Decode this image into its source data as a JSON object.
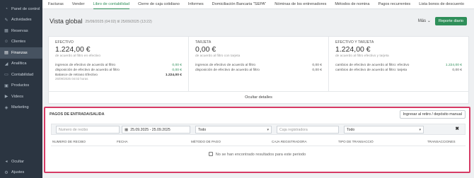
{
  "sidebar": {
    "items": [
      {
        "icon": "dashboard-icon",
        "glyph": "◔",
        "label": "Panel de control"
      },
      {
        "icon": "activities-icon",
        "glyph": "✎",
        "label": "Actividades"
      },
      {
        "icon": "calendar-icon",
        "glyph": "▦",
        "label": "Reservas"
      },
      {
        "icon": "clients-icon",
        "glyph": "☺",
        "label": "Clientes"
      },
      {
        "icon": "finance-icon",
        "glyph": "▤",
        "label": "Finanzas"
      },
      {
        "icon": "analytics-icon",
        "glyph": "◢",
        "label": "Analítica"
      },
      {
        "icon": "accounting-icon",
        "glyph": "▭",
        "label": "Contabilidad"
      },
      {
        "icon": "products-icon",
        "glyph": "▣",
        "label": "Productos"
      },
      {
        "icon": "videos-icon",
        "glyph": "▶",
        "label": "Videos"
      },
      {
        "icon": "marketing-icon",
        "glyph": "◈",
        "label": "Marketing"
      }
    ],
    "active_index": 4,
    "bottom": [
      {
        "icon": "hide-icon",
        "glyph": "◂",
        "label": "Ocultar"
      },
      {
        "icon": "settings-icon",
        "glyph": "⚙",
        "label": "Ajustes"
      }
    ]
  },
  "tabs": [
    "Facturas",
    "Vender",
    "Libro de contabilidad",
    "Cierre de caja cotidiano",
    "Informes",
    "Domiciliación Bancaria \"SEPA\"",
    "Nóminas de los entrenadores",
    "Métodos de nomina",
    "Pagos recurrentes",
    "Lista bonos de descuento"
  ],
  "active_tab": 2,
  "header": {
    "title": "Vista global",
    "daterange": "25/09/2025 (04:02) til 25/09/2025 (13:22)",
    "more": "Más",
    "report_button": "Reporte diario"
  },
  "summary": {
    "cash": {
      "label": "EFECTIVO",
      "amount": "1.224,00 €",
      "sub": "de acuerdo al filtro en efectivo",
      "rows": [
        {
          "label": "ingresos de efectivo de acuerdo al filtro",
          "value": "0,00 €",
          "style": "green"
        },
        {
          "label": "disposición de efectivo de acuerdo al filtro",
          "value": "0,00 €",
          "style": "green"
        },
        {
          "label": "Balance de retraso Efectivo",
          "value": "1.224,00 €",
          "style": "bold"
        }
      ],
      "note": "25/09/2025 04:02 horas"
    },
    "card": {
      "label": "TARJETA",
      "amount": "0,00 €",
      "sub": "de acuerdo al filtro con tarjeta",
      "rows": [
        {
          "label": "ingresos de efectivo de acuerdo al filtro",
          "value": "0,00 €",
          "style": ""
        },
        {
          "label": "disposición de efectivo de acuerdo al filtro",
          "value": "0,00 €",
          "style": ""
        }
      ]
    },
    "cash_card": {
      "label": "EFECTIVO Y TARJETA",
      "amount": "1.224,00 €",
      "sub": "de acuerdo al filtro efectivo y tarjeta",
      "rows": [
        {
          "label": "cambios de efectivo de acuerdo al filtro: efectivo",
          "value": "1.224,00 €",
          "style": "green"
        },
        {
          "label": "cambios de efectivo de acuerdo al filtro: tarjeta",
          "value": "0,00 €",
          "style": ""
        }
      ]
    },
    "details_link": "Ocultar detalles"
  },
  "payments": {
    "title": "PAGOS DE ENTRADA/SALIDA",
    "add_button": "Ingresar al retiro / depósito manual",
    "filters": {
      "receipt_placeholder": "Numero de recibo",
      "date_range": "25.09.2025 - 25.09.2025",
      "payment_method": "Todo",
      "register_placeholder": "Caja registradora",
      "transaction_type": "Todo",
      "clear": "✖"
    },
    "columns": [
      "NUMERO DE RECIBO",
      "FECHA",
      "MÉTODO DE PAGO",
      "CAJA REGISTRADORA",
      "TIPO DE TRANSACCIÓ",
      "TRANSACCIONES"
    ],
    "empty_message": "No se han encontrado resultados para este periodo"
  },
  "colors": {
    "accent": "#2f8f5a",
    "highlight_border": "#d63a64",
    "sidebar_bg": "#2b3541"
  }
}
